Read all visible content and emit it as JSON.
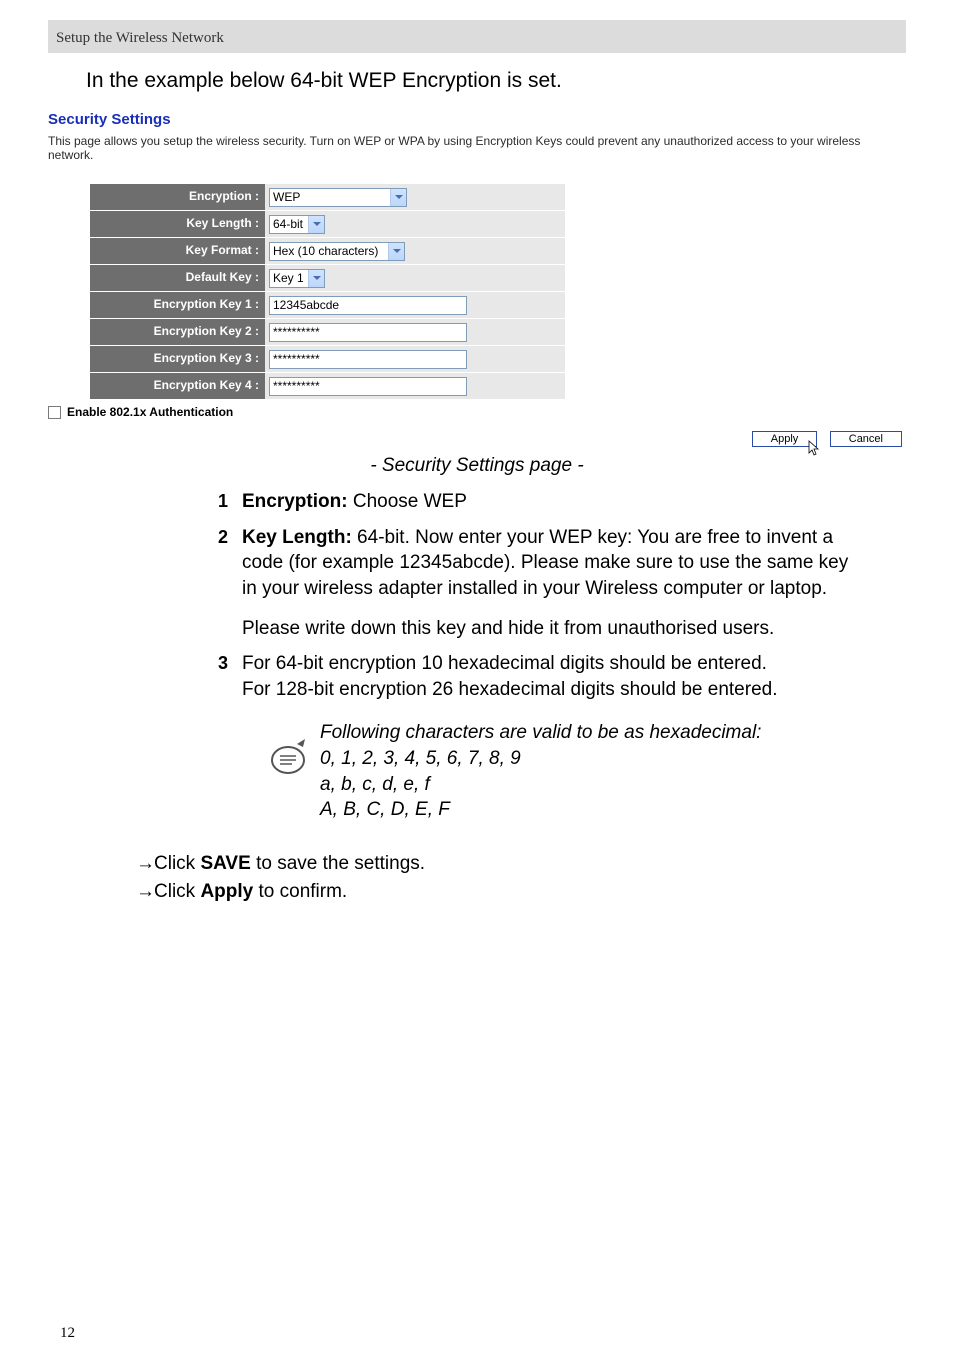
{
  "header": {
    "breadcrumb": "Setup the Wireless Network"
  },
  "intro": "In the example below 64-bit WEP Encryption is set.",
  "panel": {
    "title": "Security Settings",
    "description": "This page allows you setup the wireless security. Turn on WEP or WPA by using Encryption Keys could prevent any unauthorized access to your wireless network.",
    "fields": {
      "encryption": {
        "label": "Encryption :",
        "value": "WEP"
      },
      "key_length": {
        "label": "Key Length :",
        "value": "64-bit"
      },
      "key_format": {
        "label": "Key Format :",
        "value": "Hex (10 characters)"
      },
      "default_key": {
        "label": "Default Key :",
        "value": "Key 1"
      },
      "key1": {
        "label": "Encryption Key 1 :",
        "value": "12345abcde"
      },
      "key2": {
        "label": "Encryption Key 2 :",
        "value": "**********"
      },
      "key3": {
        "label": "Encryption Key 3 :",
        "value": "**********"
      },
      "key4": {
        "label": "Encryption Key 4 :",
        "value": "**********"
      }
    },
    "auth_checkbox": "Enable 802.1x Authentication",
    "buttons": {
      "apply": "Apply",
      "cancel": "Cancel"
    }
  },
  "caption": "- Security Settings page -",
  "list": {
    "item1": {
      "num": "1",
      "bold": "Encryption:",
      "rest": " Choose WEP"
    },
    "item2": {
      "num": "2",
      "bold": "Key Length:",
      "rest": " 64-bit. Now enter your WEP key: You are free to invent a code (for example 12345abcde). Please make sure to use the same key in your wireless adapter installed in your Wireless computer or laptop.",
      "extra": "Please write down this key and hide it from unauthorised users."
    },
    "item3": {
      "num": "3",
      "line1": "For 64-bit encryption 10 hexadecimal digits should be entered.",
      "line2": "For 128-bit encryption 26 hexadecimal digits should be entered."
    }
  },
  "note": {
    "line1": "Following characters are valid to be as hexadecimal:",
    "line2": "0, 1, 2, 3, 4, 5, 6, 7, 8, 9",
    "line3": " a, b, c, d, e, f",
    "line4": "A, B, C, D, E, F"
  },
  "actions": {
    "arrow": "→",
    "save_pre": "Click ",
    "save_bold": "SAVE",
    "save_post": " to save the settings.",
    "apply_pre": "Click ",
    "apply_bold": "Apply",
    "apply_post": " to confirm."
  },
  "page_number": "12"
}
